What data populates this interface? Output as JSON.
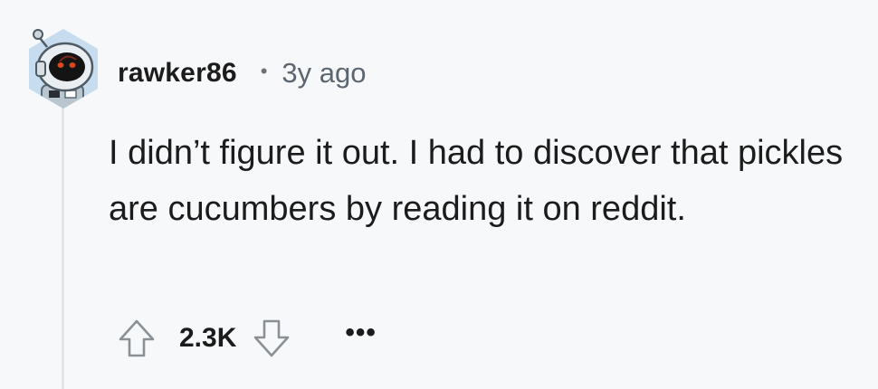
{
  "comment": {
    "author": "rawker86",
    "separator": "•",
    "age": "3y ago",
    "body": "I didn’t figure it out. I had to discover that pickles are cucumbers by reading it on reddit.",
    "score": "2.3K",
    "more_label": "•••"
  },
  "icons": {
    "avatar": "snoo-robot-avatar",
    "upvote": "upvote-arrow-icon",
    "downvote": "downvote-arrow-icon"
  },
  "colors": {
    "background": "#f7f8f9",
    "text": "#1c1c1c",
    "meta_text": "#5c6670",
    "thread_line": "#e4e7ea",
    "icon_stroke": "#8a9196"
  }
}
